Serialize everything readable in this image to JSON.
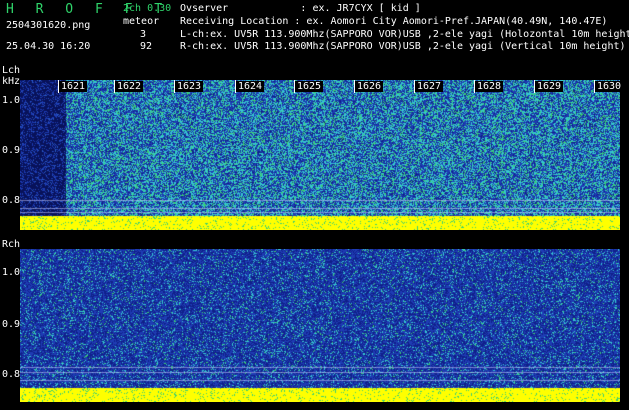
{
  "header": {
    "title": "H R O F F T",
    "filename": "2504301620.png",
    "datetime": "25.04.30 16:20",
    "mode": "2ch 0.30",
    "event_label": "meteor",
    "count_lch": "3",
    "count_rch": "92",
    "observer": "Ovserver            : ex. JR7CYX [ kid ]",
    "location": "Receiving Location : ex. Aomori City Aomori-Pref.JAPAN(40.49N, 140.47E)",
    "lch_info": "L-ch:ex. UV5R 113.900Mhz(SAPPORO VOR)USB ,2-ele yagi (Holozontal 10m height",
    "rch_info": "R-ch:ex. UV5R 113.900Mhz(SAPPORO VOR)USB ,2-ele yagi (Vertical 10m height)"
  },
  "lch": {
    "label": "Lch",
    "unit": "kHz",
    "yticks": [
      "1.0",
      "0.9",
      "0.8"
    ]
  },
  "rch": {
    "label": "Rch",
    "yticks": [
      "1.0",
      "0.9",
      "0.8"
    ]
  },
  "time_labels": [
    "1621",
    "1622",
    "1623",
    "1624",
    "1625",
    "1626",
    "1627",
    "1628",
    "1629",
    "1630"
  ],
  "colors": {
    "background": "#000000",
    "title_green": "#2fd36a",
    "carrier_yellow": "#ffff00",
    "noise_low": "#10208a",
    "noise_mid": "#1e3cb4",
    "noise_high": "#36c8d0",
    "noise_green": "#3ad070"
  }
}
